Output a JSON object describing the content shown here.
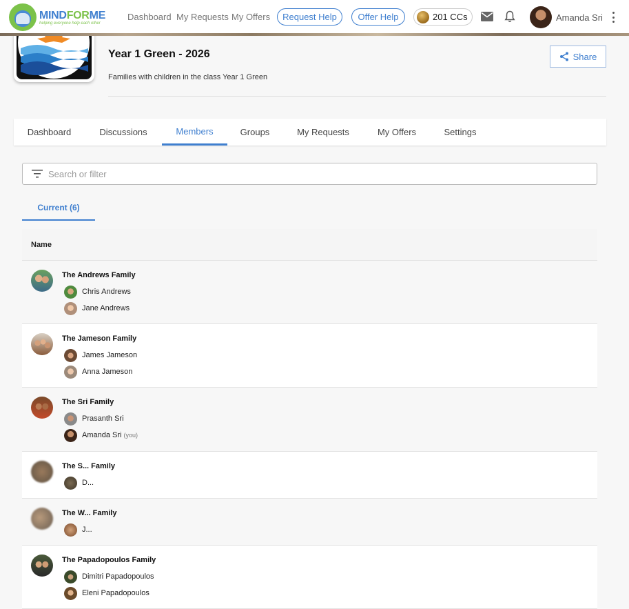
{
  "app": {
    "logo_title_1": "MIND",
    "logo_title_2": "FOR",
    "logo_title_3": "ME",
    "logo_tagline": "helping everyone help each other"
  },
  "nav": {
    "dashboard": "Dashboard",
    "my_requests": "My Requests",
    "my_offers": "My Offers",
    "request_help": "Request Help",
    "offer_help": "Offer Help",
    "credits": "201 CCs",
    "user_name": "Amanda Sri"
  },
  "group": {
    "title": "Year 1 Green - 2026",
    "description": "Families with children in the class Year 1 Green",
    "share_label": "Share"
  },
  "tabs": [
    "Dashboard",
    "Discussions",
    "Members",
    "Groups",
    "My Requests",
    "My Offers",
    "Settings"
  ],
  "active_tab": "Members",
  "search": {
    "placeholder": "Search or filter"
  },
  "subtab": {
    "label": "Current (6)"
  },
  "table": {
    "header_name": "Name",
    "families": [
      {
        "name": "The Andrews Family",
        "members": [
          {
            "name": "Chris Andrews"
          },
          {
            "name": "Jane Andrews"
          }
        ]
      },
      {
        "name": "The Jameson Family",
        "members": [
          {
            "name": "James Jameson"
          },
          {
            "name": "Anna Jameson"
          }
        ]
      },
      {
        "name": "The Sri Family",
        "members": [
          {
            "name": "Prasanth Sri"
          },
          {
            "name": "Amanda Sri",
            "tag": "(you)"
          }
        ]
      },
      {
        "name": "The S... Family",
        "members": [
          {
            "name": "D..."
          }
        ]
      },
      {
        "name": "The W... Family",
        "members": [
          {
            "name": "J..."
          }
        ]
      },
      {
        "name": "The Papadopoulos Family",
        "members": [
          {
            "name": "Dimitri Papadopoulos"
          },
          {
            "name": "Eleni Papadopoulos"
          }
        ]
      }
    ]
  },
  "colors": {
    "accent": "#3f7fcf",
    "brand_green": "#7cc24a"
  }
}
